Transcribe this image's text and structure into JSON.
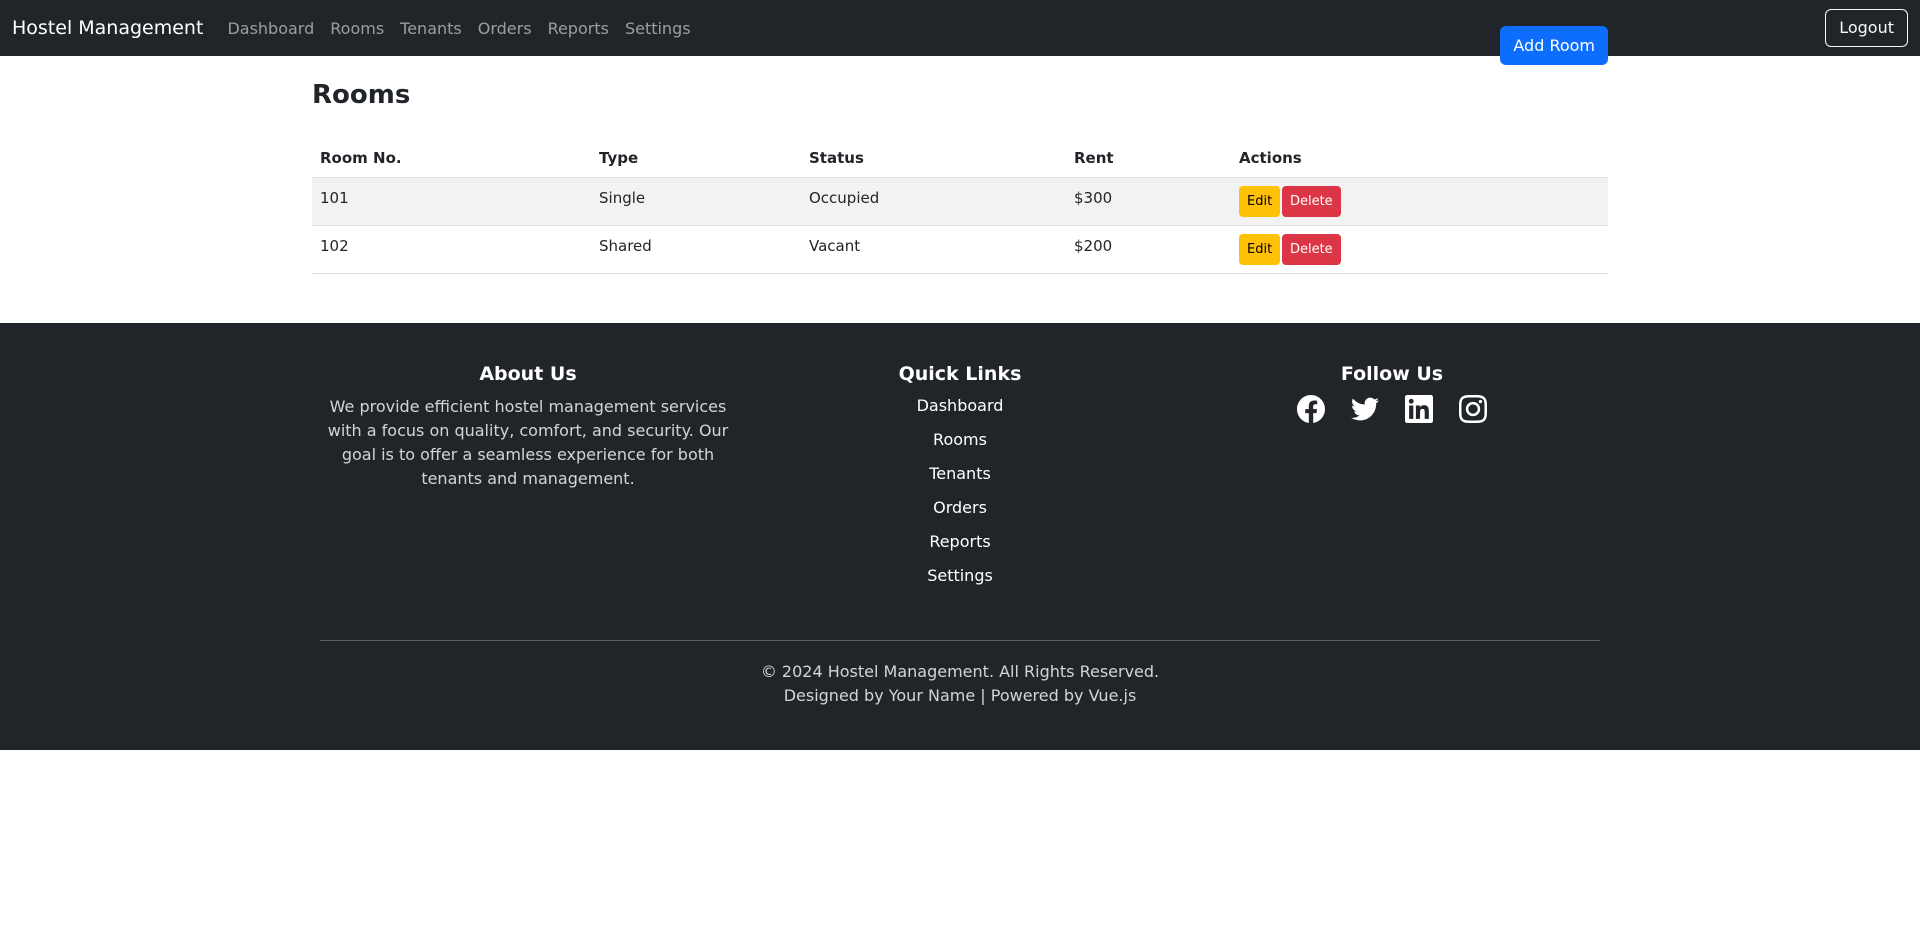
{
  "navbar": {
    "brand": "Hostel Management",
    "links": [
      "Dashboard",
      "Rooms",
      "Tenants",
      "Orders",
      "Reports",
      "Settings"
    ],
    "logout_label": "Logout"
  },
  "main": {
    "title": "Rooms",
    "add_button_label": "Add Room",
    "table": {
      "headers": [
        "Room No.",
        "Type",
        "Status",
        "Rent",
        "Actions"
      ],
      "rows": [
        {
          "room_no": "101",
          "type": "Single",
          "status": "Occupied",
          "rent": "$300",
          "edit_label": "Edit",
          "delete_label": "Delete"
        },
        {
          "room_no": "102",
          "type": "Shared",
          "status": "Vacant",
          "rent": "$200",
          "edit_label": "Edit",
          "delete_label": "Delete"
        }
      ]
    }
  },
  "footer": {
    "about": {
      "title": "About Us",
      "text": "We provide efficient hostel management services with a focus on quality, comfort, and security. Our goal is to offer a seamless experience for both tenants and management."
    },
    "quick_links": {
      "title": "Quick Links",
      "items": [
        "Dashboard",
        "Rooms",
        "Tenants",
        "Orders",
        "Reports",
        "Settings"
      ]
    },
    "follow": {
      "title": "Follow Us",
      "icons": [
        "facebook-icon",
        "twitter-icon",
        "linkedin-icon",
        "instagram-icon"
      ]
    },
    "copyright": "© 2024 Hostel Management. All Rights Reserved.",
    "credits": "Designed by Your Name | Powered by Vue.js"
  },
  "colors": {
    "navbar_bg": "#212529",
    "primary": "#0d6efd",
    "warning": "#ffc107",
    "danger": "#dc3545"
  }
}
